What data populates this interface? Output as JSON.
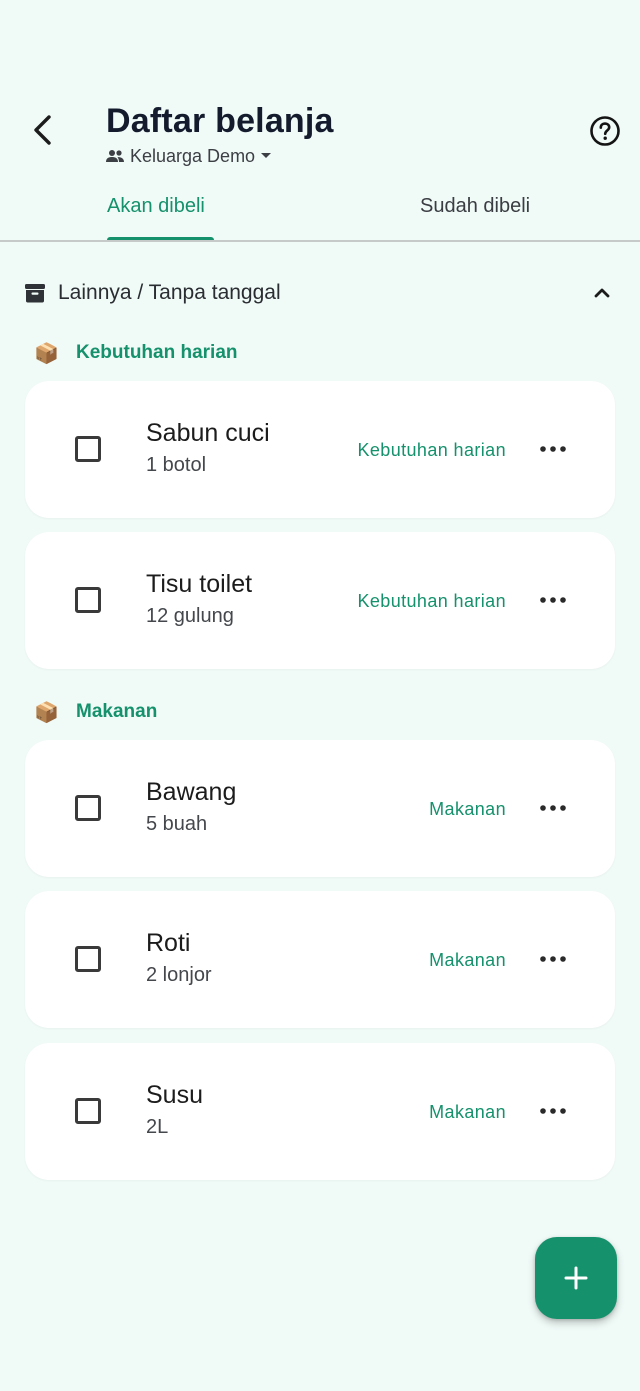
{
  "header": {
    "title": "Daftar belanja",
    "family_name": "Keluarga Demo"
  },
  "tabs": [
    {
      "label": "Akan dibeli",
      "active": true
    },
    {
      "label": "Sudah dibeli",
      "active": false
    }
  ],
  "section": {
    "label": "Lainnya / Tanpa tanggal",
    "expanded": true
  },
  "groups": [
    {
      "emoji": "📦",
      "label": "Kebutuhan harian",
      "items": [
        {
          "name": "Sabun cuci",
          "qty": "1 botol",
          "tag": "Kebutuhan harian",
          "checked": false
        },
        {
          "name": "Tisu toilet",
          "qty": "12 gulung",
          "tag": "Kebutuhan harian",
          "checked": false
        }
      ]
    },
    {
      "emoji": "📦",
      "label": "Makanan",
      "items": [
        {
          "name": "Bawang",
          "qty": "5 buah",
          "tag": "Makanan",
          "checked": false
        },
        {
          "name": "Roti",
          "qty": "2 lonjor",
          "tag": "Makanan",
          "checked": false
        },
        {
          "name": "Susu",
          "qty": "2L",
          "tag": "Makanan",
          "checked": false
        }
      ]
    }
  ],
  "colors": {
    "accent": "#15916b",
    "background": "#f0faf7",
    "card": "#ffffff"
  },
  "icons": {
    "back": "arrow-back-icon",
    "family": "people-icon",
    "dropdown": "caret-down-icon",
    "help": "help-circle-icon",
    "section": "archive-box-icon",
    "collapse": "chevron-up-icon",
    "more": "more-horizontal-icon",
    "add": "plus-icon"
  }
}
